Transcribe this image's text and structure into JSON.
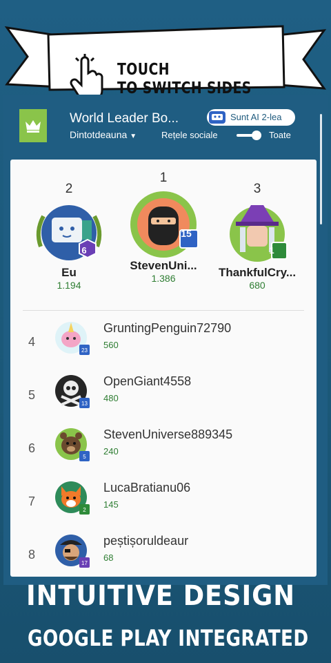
{
  "banner": {
    "line1": "TOUCH",
    "line2": "TO SWITCH SIDES"
  },
  "header": {
    "title": "World Leader Bo...",
    "ai_badge": "Sunt AI 2-lea",
    "filter": "Dintotdeauna",
    "social": "Rețele sociale",
    "all": "Toate"
  },
  "podium": [
    {
      "rank": "2",
      "name": "Eu",
      "score": "1.194",
      "level": "6",
      "level_color": "#6a3fb5"
    },
    {
      "rank": "1",
      "name": "StevenUni...",
      "score": "1.386",
      "level": "15",
      "level_color": "#2f63c4"
    },
    {
      "rank": "3",
      "name": "ThankfulCry...",
      "score": "680",
      "level": "1",
      "level_color": "#2e8b3a"
    }
  ],
  "rows": [
    {
      "rank": "4",
      "name": "GruntingPenguin72790",
      "score": "560",
      "level": "23",
      "avatar": "unicorn-avatar"
    },
    {
      "rank": "5",
      "name": "OpenGiant4558",
      "score": "480",
      "level": "13",
      "avatar": "skull-avatar"
    },
    {
      "rank": "6",
      "name": "StevenUniverse889345",
      "score": "240",
      "level": "5",
      "avatar": "bear-avatar"
    },
    {
      "rank": "7",
      "name": "LucaBratianu06",
      "score": "145",
      "level": "2",
      "avatar": "fox-avatar"
    },
    {
      "rank": "8",
      "name": "peștișoruldeaur",
      "score": "68",
      "level": "17",
      "avatar": "pirate-avatar"
    }
  ],
  "promo": {
    "line1": "INTUITIVE DESIGN",
    "line2": "GOOGLE PLAY INTEGRATED"
  },
  "colors": {
    "background": "#1e5a7d",
    "accent_green": "#8ac44a",
    "score_green": "#2e7d32"
  }
}
